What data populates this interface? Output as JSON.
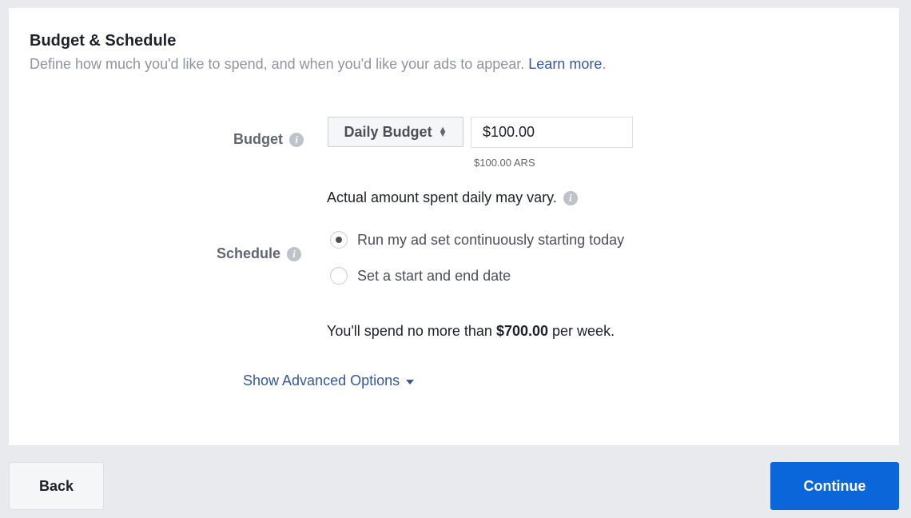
{
  "section": {
    "title": "Budget & Schedule",
    "subtitle": "Define how much you'd like to spend, and when you'd like your ads to appear.",
    "learn_more": "Learn more",
    "subtitle_end": "."
  },
  "budget": {
    "label": "Budget",
    "info_icon": "info-icon",
    "type_selected": "Daily Budget",
    "amount_value": "$100.00",
    "converted_amount": "$100.00 ARS",
    "note": "Actual amount spent daily may vary."
  },
  "schedule": {
    "label": "Schedule",
    "options": [
      {
        "label": "Run my ad set continuously starting today",
        "selected": true
      },
      {
        "label": "Set a start and end date",
        "selected": false
      }
    ]
  },
  "spend_summary": {
    "prefix": "You'll spend no more than",
    "amount": "$700.00",
    "suffix": "per week."
  },
  "advanced_options": {
    "label": "Show Advanced Options",
    "icon": "caret-down-icon"
  },
  "footer": {
    "back_label": "Back",
    "continue_label": "Continue",
    "continue_color": "#0a66d9"
  }
}
